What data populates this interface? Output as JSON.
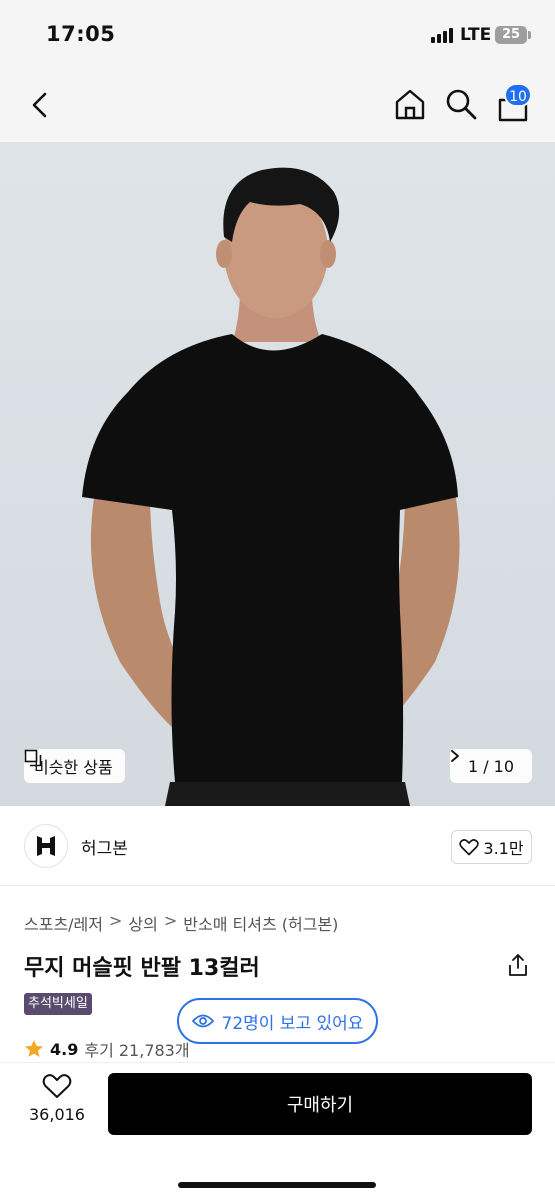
{
  "status_bar": {
    "time": "17:05",
    "network": "LTE",
    "battery": "25"
  },
  "nav": {
    "cart_count": "10",
    "icons": [
      "back-icon",
      "home-icon",
      "search-icon",
      "shopping-bag-icon"
    ]
  },
  "hero": {
    "similar_label": "비슷한 상품",
    "counter": "1 / 10",
    "similar_icon": "copy-icon",
    "counter_icon": "chevron-right-icon"
  },
  "brand": {
    "name": "허그본",
    "likes": "3.1만"
  },
  "breadcrumb": [
    "스포츠/레저",
    "상의",
    "반소매 티셔츠 (허그본)"
  ],
  "product": {
    "title": "무지 머슬핏 반팔 13컬러",
    "badge": "추석빅세일"
  },
  "viewers": {
    "text": "72명이 보고 있어요"
  },
  "rating": {
    "score": "4.9",
    "reviews": "후기 21,783개"
  },
  "bottom": {
    "wish_count": "36,016",
    "buy_label": "구매하기"
  },
  "colors": {
    "accent": "#2f72e8",
    "badge_bg": "#5b4b6e",
    "buy_bg": "#000000",
    "cart_badge": "#1e6ff1"
  }
}
